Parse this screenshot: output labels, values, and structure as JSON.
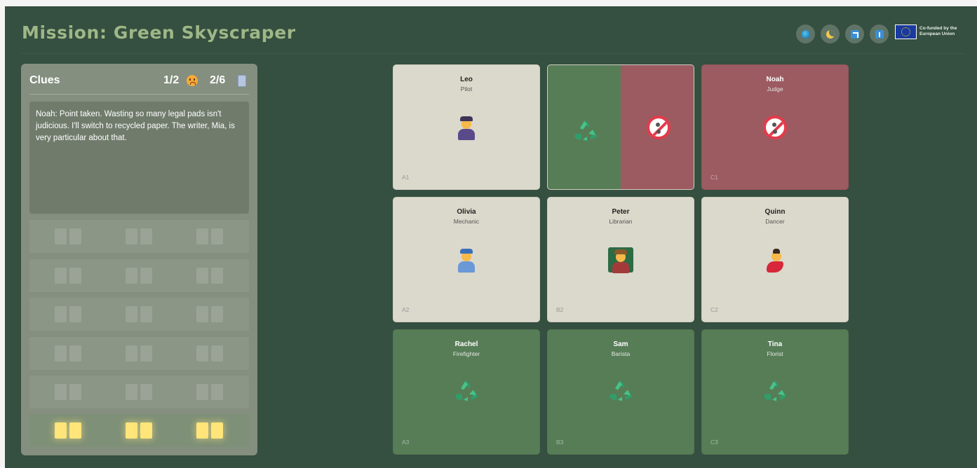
{
  "title": "Mission: Green Skyscraper",
  "header_buttons": [
    {
      "icon": "globe-icon"
    },
    {
      "icon": "moon-icon"
    },
    {
      "icon": "expand-icon"
    },
    {
      "icon": "info-icon"
    }
  ],
  "eu_logo": {
    "text": "Co-funded by the European Union",
    "colors": {
      "flag": "#1a3aa0",
      "stars": "#ffdd00"
    }
  },
  "clues": {
    "title": "Clues",
    "mistakes": "1/2",
    "progress": "2/6",
    "text": "Noah: Point taken. Wasting so many legal pads isn't judicious. I'll switch to recycled paper. The writer, Mia, is very particular about that."
  },
  "building": {
    "floors": [
      {
        "lit": false
      },
      {
        "lit": false
      },
      {
        "lit": false
      },
      {
        "lit": false
      },
      {
        "lit": false
      },
      {
        "lit": true
      }
    ]
  },
  "grid": [
    {
      "name": "Leo",
      "job": "Pilot",
      "pos": "A1",
      "state": "neutral",
      "icon": "pilot-icon"
    },
    {
      "name": "",
      "job": "",
      "pos": "",
      "state": "split",
      "icon": "recycle-icon"
    },
    {
      "name": "Noah",
      "job": "Judge",
      "pos": "C1",
      "state": "red",
      "icon": "no-littering-icon"
    },
    {
      "name": "Olivia",
      "job": "Mechanic",
      "pos": "A2",
      "state": "neutral",
      "icon": "mechanic-icon"
    },
    {
      "name": "Peter",
      "job": "Librarian",
      "pos": "B2",
      "state": "neutral",
      "icon": "teacher-icon"
    },
    {
      "name": "Quinn",
      "job": "Dancer",
      "pos": "C2",
      "state": "neutral",
      "icon": "dancer-icon"
    },
    {
      "name": "Rachel",
      "job": "Firefighter",
      "pos": "A3",
      "state": "green",
      "icon": "recycle-icon"
    },
    {
      "name": "Sam",
      "job": "Barista",
      "pos": "B3",
      "state": "green",
      "icon": "recycle-icon"
    },
    {
      "name": "Tina",
      "job": "Florist",
      "pos": "C3",
      "state": "green",
      "icon": "recycle-icon"
    }
  ],
  "colors": {
    "background": "#354f40",
    "title": "#9fb787",
    "card_neutral": "#dbd8cc",
    "card_green": "#577d57",
    "card_red": "#9c5b61",
    "window_lit": "#ffe57a"
  }
}
